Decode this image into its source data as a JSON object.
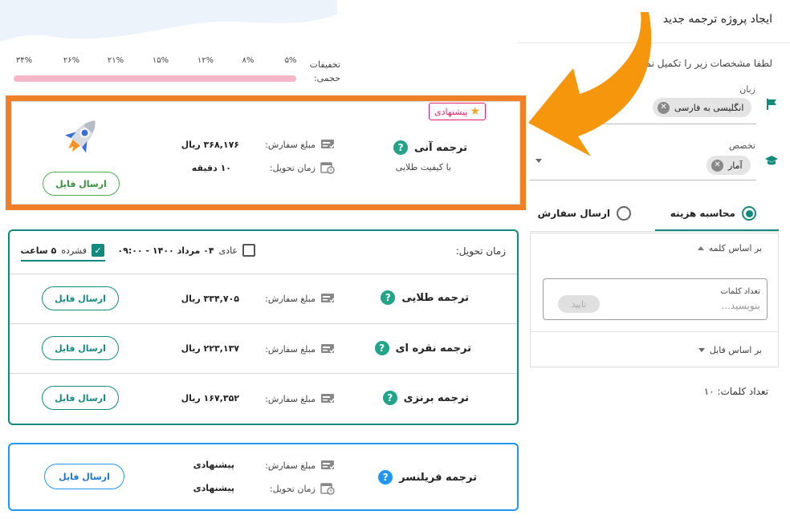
{
  "header": {
    "title": "ایجاد پروژه ترجمه جدید",
    "subtitle": "لطفا مشخصات زیر را تکمیل نمایید"
  },
  "discounts": {
    "label_line1": "تخفیفات",
    "label_line2": "حجمی:",
    "ticks": [
      "۵%",
      "۸%",
      "۱۲%",
      "۱۵%",
      "۲۱%",
      "۲۶%",
      "۳۴%"
    ]
  },
  "language": {
    "label": "زبان",
    "chip": "انگلیسی به فارسی",
    "icon": "flag-icon"
  },
  "specialty": {
    "label": "تخصص",
    "chip": "آمار",
    "icon": "graduation-cap-icon"
  },
  "tabs": [
    {
      "label": "محاسبه هزینه",
      "selected": true
    },
    {
      "label": "ارسال سفارش",
      "selected": false
    }
  ],
  "cost": {
    "by_word": "بر اساس کلمه",
    "word_input_label": "تعداد کلمات",
    "word_input_placeholder": "بنویسید...",
    "confirm": "تایید",
    "by_file": "بر اساس فایل",
    "word_count_text": "تعداد کلمات: ۱۰"
  },
  "instant": {
    "name": "ترجمه آنی",
    "sub": "با کیفیت طلایی",
    "badge": "پیشنهادی",
    "amount_label": "مبلغ سفارش:",
    "amount": "۳۶۸,۱۷۶ ریال",
    "time_label": "زمان تحویل:",
    "time": "۱۰ دقیقه",
    "send": "ارسال فایل"
  },
  "delivery": {
    "label": "زمان تحویل:",
    "normal_prefix": "عادی",
    "normal_value": "۰۴ مرداد ۱۴۰۰ - ۰۹:۰۰",
    "fast_prefix": "فشرده",
    "fast_value": "۵ ساعت"
  },
  "tiers": [
    {
      "name": "ترجمه طلایی",
      "amount_label": "مبلغ سفارش:",
      "amount": "۳۳۴,۷۰۵ ریال",
      "send": "ارسال فایل"
    },
    {
      "name": "ترجمه نقره ای",
      "amount_label": "مبلغ سفارش:",
      "amount": "۲۲۳,۱۳۷ ریال",
      "send": "ارسال فایل"
    },
    {
      "name": "ترجمه برنزی",
      "amount_label": "مبلغ سفارش:",
      "amount": "۱۶۷,۳۵۲ ریال",
      "send": "ارسال فایل"
    }
  ],
  "freelancer": {
    "name": "ترجمه فریلنسر",
    "amount_label": "مبلغ سفارش:",
    "amount": "پیشنهادی",
    "time_label": "زمان تحویل:",
    "time": "پیشنهادی",
    "send": "ارسال فایل"
  },
  "colors": {
    "accent": "#138a7e",
    "highlight_border": "#f07f25",
    "arrow": "#f5960c",
    "freelancer_border": "#2196f3",
    "discount_bar": "#f5b7c8"
  }
}
